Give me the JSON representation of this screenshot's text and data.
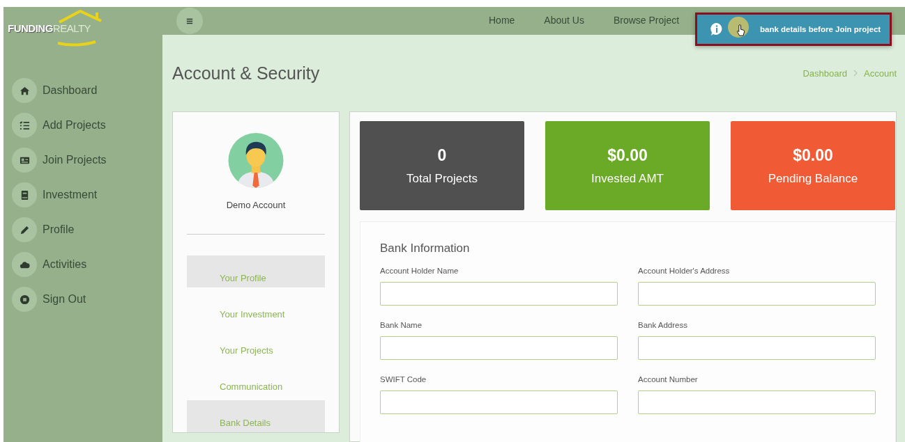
{
  "brand": {
    "word_1": "FUNDING",
    "word_2": "REALTY"
  },
  "topnav": [
    "Home",
    "About Us",
    "Browse Project"
  ],
  "toast": {
    "message": "bank details before Join project"
  },
  "sidebar": {
    "items": [
      {
        "kind": "home",
        "label": "Dashboard"
      },
      {
        "kind": "list",
        "label": "Add Projects"
      },
      {
        "kind": "card",
        "label": "Join Projects"
      },
      {
        "kind": "book",
        "label": "Investment"
      },
      {
        "kind": "pencil",
        "label": "Profile"
      },
      {
        "kind": "cloud",
        "label": "Activities"
      },
      {
        "kind": "signout",
        "label": "Sign Out"
      }
    ]
  },
  "page": {
    "title": "Account & Security",
    "breadcrumb": [
      "Dashboard",
      "Account"
    ]
  },
  "profile": {
    "name": "Demo Account",
    "menu": [
      {
        "label": "Your Profile",
        "selected": true
      },
      {
        "label": "Your Investment",
        "selected": false
      },
      {
        "label": "Your Projects",
        "selected": false
      },
      {
        "label": "Communication",
        "selected": false
      },
      {
        "label": "Bank Details",
        "selected": true
      }
    ]
  },
  "stats": [
    {
      "value": "0",
      "label": "Total Projects",
      "color": "#505050"
    },
    {
      "value": "$0.00",
      "label": "Invested AMT",
      "color": "#6aaa26"
    },
    {
      "value": "$0.00",
      "label": "Pending Balance",
      "color": "#f05a35"
    }
  ],
  "bank_form": {
    "title": "Bank Information",
    "fields": [
      {
        "label": "Account Holder Name"
      },
      {
        "label": "Account Holder's Address"
      },
      {
        "label": "Bank Name"
      },
      {
        "label": "Bank Address"
      },
      {
        "label": "SWIFT Code"
      },
      {
        "label": "Account Number"
      }
    ]
  }
}
